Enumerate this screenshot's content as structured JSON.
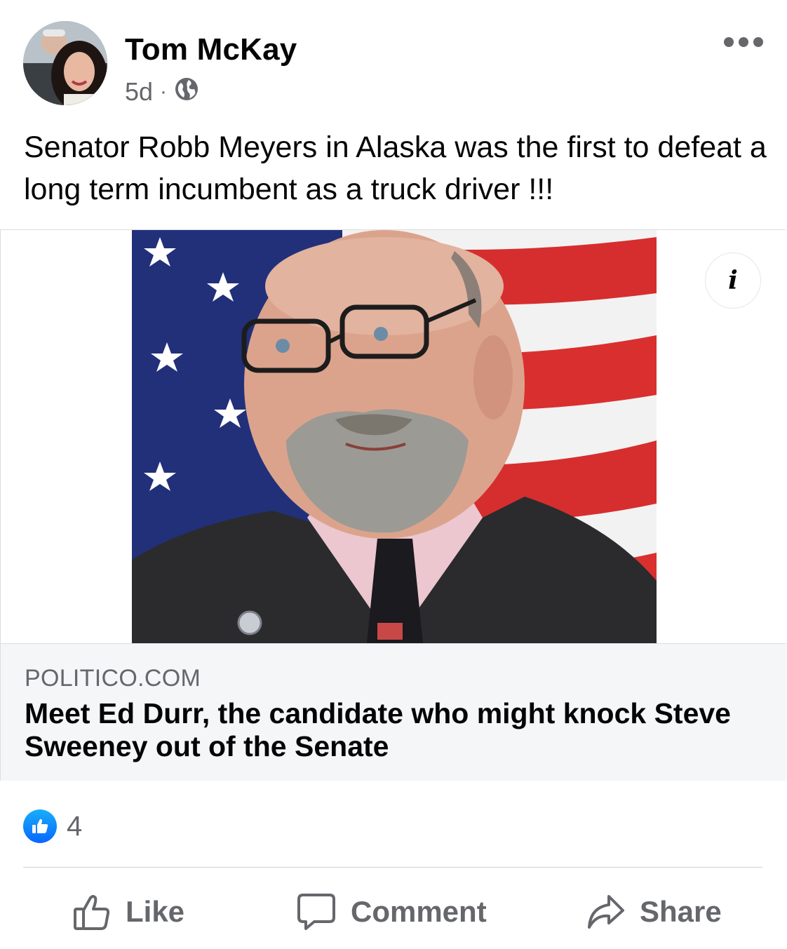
{
  "post": {
    "author": "Tom McKay",
    "time": "5d",
    "separator": "·",
    "privacy_icon": "globe-icon",
    "caption": "Senator Robb Meyers in Alaska was the first to defeat a long term incumbent as a truck driver !!!"
  },
  "link_preview": {
    "domain": "POLITICO.COM",
    "headline": "Meet Ed Durr, the candidate who might knock Steve Sweeney out of the Senate",
    "info_label": "i"
  },
  "reactions": {
    "icon": "like-reaction-icon",
    "count": "4"
  },
  "actions": {
    "like": "Like",
    "comment": "Comment",
    "share": "Share"
  },
  "colors": {
    "text_primary": "#050505",
    "text_secondary": "#65676b",
    "link_footer_bg": "#f5f6f8",
    "like_blue": "#0866ff"
  }
}
